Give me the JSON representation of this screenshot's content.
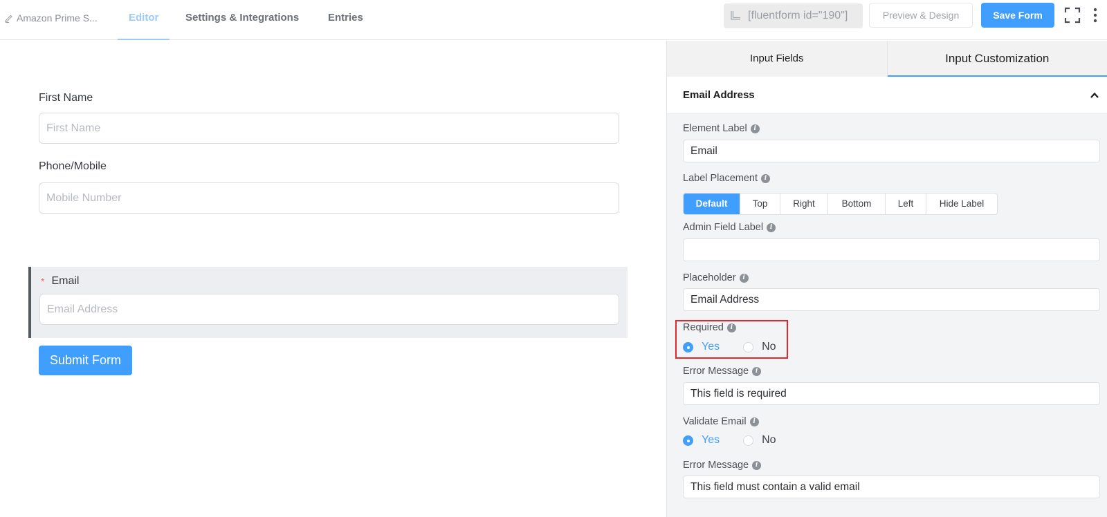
{
  "header": {
    "form_name": "Amazon Prime S...",
    "tabs": [
      {
        "label": "Editor",
        "active": true
      },
      {
        "label": "Settings & Integrations",
        "active": false
      },
      {
        "label": "Entries",
        "active": false
      }
    ],
    "shortcode": "[fluentform id=\"190\"]",
    "preview_label": "Preview & Design",
    "save_label": "Save Form"
  },
  "form": {
    "fields": [
      {
        "label": "First Name",
        "placeholder": "First Name",
        "required": false
      },
      {
        "label": "Phone/Mobile",
        "placeholder": "Mobile Number",
        "required": false
      },
      {
        "label": "Email",
        "placeholder": "Email Address",
        "required": true,
        "selected": true
      }
    ],
    "required_mark": "*",
    "submit_label": "Submit Form"
  },
  "panel": {
    "tabs": [
      {
        "label": "Input Fields",
        "active": false
      },
      {
        "label": "Input Customization",
        "active": true
      }
    ],
    "section_title": "Email Address",
    "element_label": {
      "label": "Element Label",
      "value": "Email"
    },
    "label_placement": {
      "label": "Label Placement",
      "options": [
        "Default",
        "Top",
        "Right",
        "Bottom",
        "Left",
        "Hide Label"
      ],
      "selected": "Default"
    },
    "admin_field_label": {
      "label": "Admin Field Label",
      "value": ""
    },
    "placeholder": {
      "label": "Placeholder",
      "value": "Email Address"
    },
    "required": {
      "label": "Required",
      "options": [
        "Yes",
        "No"
      ],
      "selected": "Yes"
    },
    "error_message": {
      "label": "Error Message",
      "value": "This field is required"
    },
    "validate_email": {
      "label": "Validate Email",
      "options": [
        "Yes",
        "No"
      ],
      "selected": "Yes"
    },
    "validate_error_message": {
      "label": "Error Message",
      "value": "This field must contain a valid email"
    }
  },
  "colors": {
    "accent": "#409eff",
    "highlight": "#e8262a",
    "required_star": "#f56c6c"
  }
}
